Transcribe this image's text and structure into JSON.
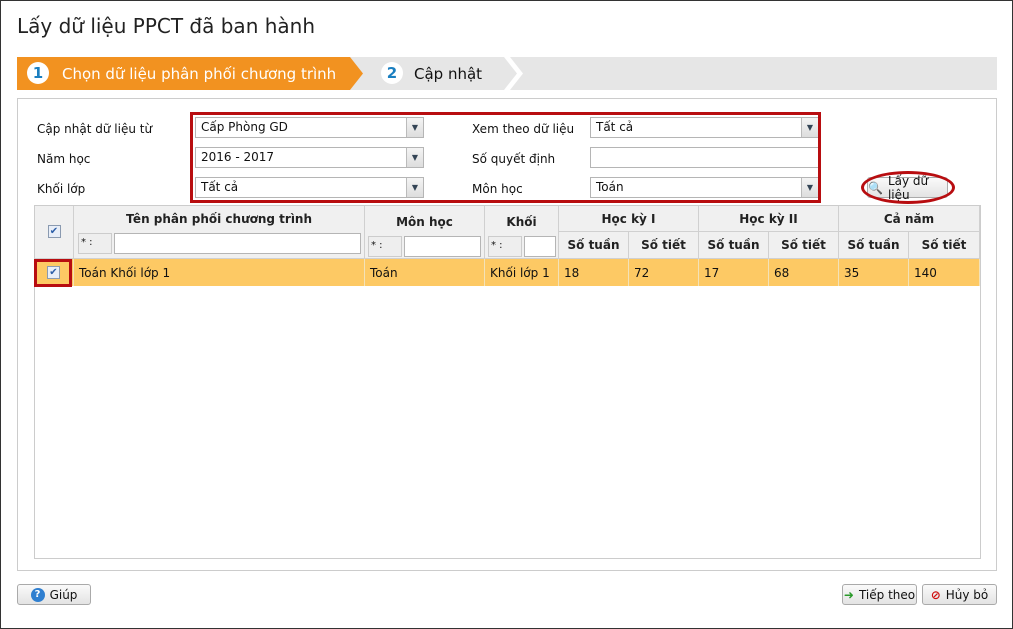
{
  "title": "Lấy dữ liệu PPCT đã ban hành",
  "steps": [
    {
      "num": "1",
      "label": "Chọn dữ liệu phân phối chương trình"
    },
    {
      "num": "2",
      "label": "Cập nhật"
    }
  ],
  "form": {
    "cap_nhat_label": "Cập nhật dữ liệu từ",
    "cap_nhat_value": "Cấp Phòng GD",
    "nam_hoc_label": "Năm học",
    "nam_hoc_value": "2016 - 2017",
    "khoi_lop_label": "Khối lớp",
    "khoi_lop_value": "Tất cả",
    "xem_theo_label": "Xem theo dữ liệu",
    "xem_theo_value": "Tất cả",
    "so_qd_label": "Số quyết định",
    "so_qd_value": "",
    "mon_hoc_label": "Môn học",
    "mon_hoc_value": "Toán",
    "fetch_button": "Lấy dữ liệu"
  },
  "grid": {
    "headers": {
      "name": "Tên phân phối chương trình",
      "mon": "Môn học",
      "khoi": "Khối",
      "hk1": "Học kỳ I",
      "hk2": "Học kỳ II",
      "cn": "Cả năm",
      "so_tuan": "Số tuần",
      "so_tiet": "Số tiết"
    },
    "filter_op": "* :",
    "rows": [
      {
        "checked": true,
        "name": "Toán Khối lớp 1",
        "mon": "Toán",
        "khoi": "Khối lớp 1",
        "hk1_tuan": "18",
        "hk1_tiet": "72",
        "hk2_tuan": "17",
        "hk2_tiet": "68",
        "cn_tuan": "35",
        "cn_tiet": "140"
      }
    ]
  },
  "footer": {
    "help": "Giúp",
    "next": "Tiếp theo",
    "cancel": "Hủy bỏ"
  }
}
